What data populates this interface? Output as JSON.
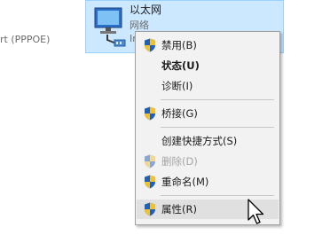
{
  "background": {
    "left_text": "rt (PPPOE)"
  },
  "adapter": {
    "name": "以太网",
    "status": "网络",
    "device_fragment": "In"
  },
  "menu": {
    "items": [
      {
        "label": "禁用(B)",
        "icon": "uac-shield-icon"
      },
      {
        "label": "状态(U)"
      },
      {
        "label": "诊断(I)"
      },
      {
        "label": "桥接(G)",
        "icon": "uac-shield-icon"
      },
      {
        "label": "创建快捷方式(S)"
      },
      {
        "label": "删除(D)",
        "icon": "uac-shield-icon",
        "disabled": true
      },
      {
        "label": "重命名(M)",
        "icon": "uac-shield-icon"
      },
      {
        "label": "属性(R)",
        "icon": "uac-shield-icon",
        "highlighted": true
      }
    ]
  },
  "colors": {
    "selection_fill": "#cce8ff",
    "menu_bg": "#f2f2f2",
    "menu_hover": "#e0e0e0",
    "shield_blue": "#1f5fbf",
    "shield_yellow": "#f2c12e"
  }
}
